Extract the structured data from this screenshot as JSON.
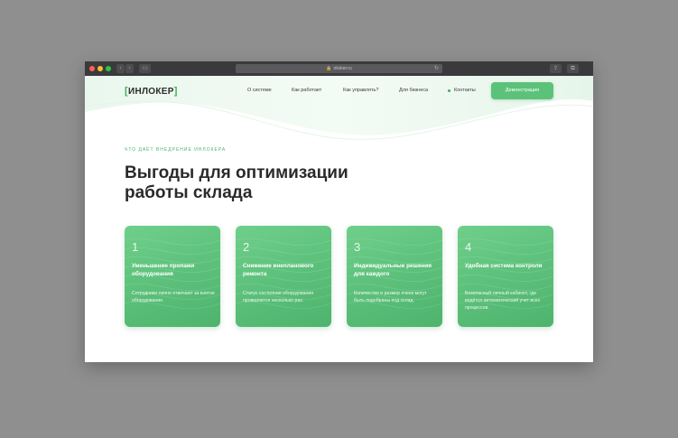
{
  "browser": {
    "url": "inloker.ru",
    "back_icon": "chevron-left",
    "forward_icon": "chevron-right",
    "sidebar_icon": "sidebar",
    "share_icon": "share",
    "tabs_icon": "tabs"
  },
  "header": {
    "logo_left_bracket": "[",
    "logo_text": "ИНЛОКЕР",
    "logo_right_bracket": "]",
    "nav": [
      "О системе",
      "Как работает",
      "Как управлять?",
      "Для бизнеса",
      "Контакты"
    ],
    "cta_label": "Демонстрация"
  },
  "hero": {
    "eyebrow": "ЧТО ДАЁТ ВНЕДРЕНИЕ ИНЛОКЕРА",
    "title_line1": "Выгоды для оптимизации",
    "title_line2": "работы склада"
  },
  "cards": [
    {
      "number": "1",
      "title": "Уменьшение пропажи оборудования",
      "description": "Сотрудники лично отвечают за взятое оборудование."
    },
    {
      "number": "2",
      "title": "Снижение внепланового ремонта",
      "description": "Статус состояния оборудования проверяется несколько раз."
    },
    {
      "number": "3",
      "title": "Индивидуальные решения для каждого",
      "description": "Количество и размер ячеек могут быть подобраны под склад."
    },
    {
      "number": "4",
      "title": "Удобная система контроля",
      "description": "Безопасный личный кабинет, где ведётся автоматический учет всех процессов."
    }
  ],
  "colors": {
    "accent": "#5cc27a",
    "brand_green": "#3fae5d",
    "heading": "#2a2a2a"
  }
}
